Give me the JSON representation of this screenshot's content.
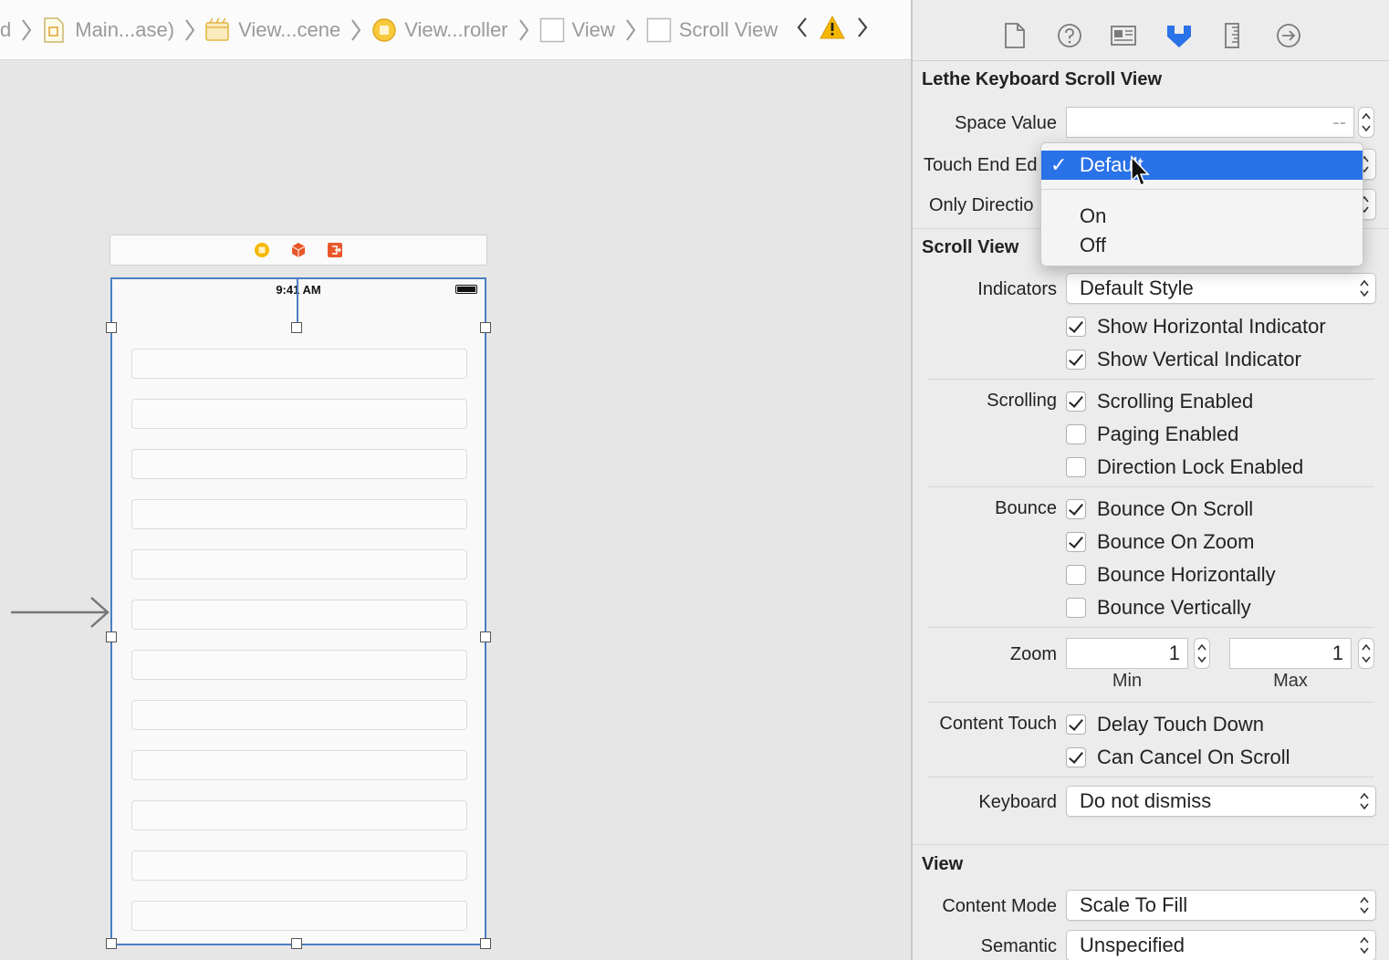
{
  "jump_bar": {
    "crumbs": [
      {
        "label": "d"
      },
      {
        "label": "Main...ase)"
      },
      {
        "label": "View...cene"
      },
      {
        "label": "View...roller"
      },
      {
        "label": "View"
      },
      {
        "label": "Scroll View"
      }
    ]
  },
  "canvas": {
    "status_time": "9:41 AM"
  },
  "inspector": {
    "custom_section": {
      "title": "Lethe Keyboard Scroll View",
      "space_value_label": "Space Value",
      "space_value_placeholder": "--",
      "touch_end_label": "Touch End Ed",
      "only_direction_label": "Only Directio"
    },
    "scroll_section": {
      "title": "Scroll View",
      "indicators_label": "Indicators",
      "indicators_value": "Default Style",
      "show_horizontal": "Show Horizontal Indicator",
      "show_vertical": "Show Vertical Indicator",
      "scrolling_label": "Scrolling",
      "scrolling_enabled": "Scrolling Enabled",
      "paging_enabled": "Paging Enabled",
      "direction_lock": "Direction Lock Enabled",
      "bounce_label": "Bounce",
      "bounce_on_scroll": "Bounce On Scroll",
      "bounce_on_zoom": "Bounce On Zoom",
      "bounce_horizontally": "Bounce Horizontally",
      "bounce_vertically": "Bounce Vertically",
      "zoom_label": "Zoom",
      "zoom_min_value": "1",
      "zoom_max_value": "1",
      "zoom_min_label": "Min",
      "zoom_max_label": "Max",
      "content_touch_label": "Content Touch",
      "delay_touch_down": "Delay Touch Down",
      "can_cancel_on_scroll": "Can Cancel On Scroll",
      "keyboard_label": "Keyboard",
      "keyboard_value": "Do not dismiss"
    },
    "view_section": {
      "title": "View",
      "content_mode_label": "Content Mode",
      "content_mode_value": "Scale To Fill",
      "semantic_label": "Semantic",
      "semantic_value": "Unspecified"
    }
  },
  "dropdown_menu": {
    "items": [
      "Default",
      "On",
      "Off"
    ],
    "selected": "Default"
  },
  "colors": {
    "selection_blue": "#2a72e8",
    "inspector_active_tab": "#2a72e8",
    "warning_yellow": "#f5b800",
    "scene_orange": "#f5a623",
    "scene_red": "#e8572a"
  }
}
